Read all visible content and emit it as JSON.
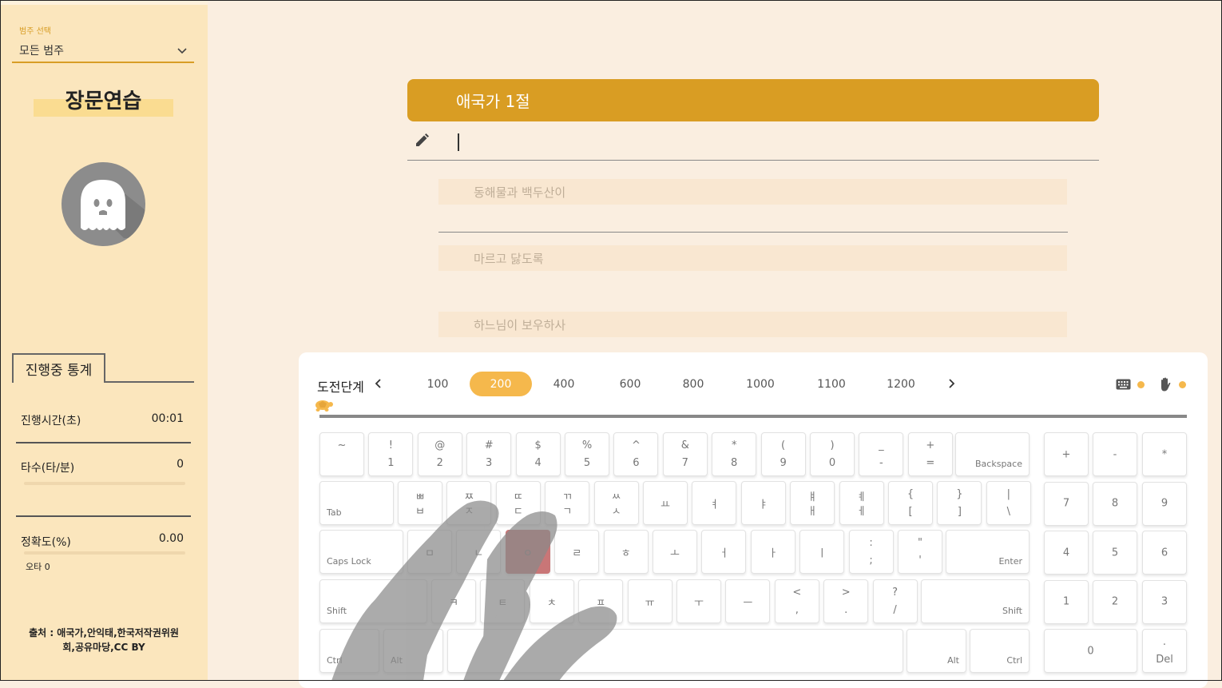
{
  "sidebar": {
    "category_label": "범주 선택",
    "category_value": "모든 범주",
    "title": "장문연습",
    "stats_tab": "진행중 통계",
    "stats": {
      "time_label": "진행시간(초)",
      "time_value": "00:01",
      "speed_label": "타수(타/분)",
      "speed_value": "0",
      "speed_progress": 0,
      "accuracy_label": "정확도(%)",
      "accuracy_value": "0.00",
      "accuracy_progress": 0,
      "typo_label": "오타 0"
    },
    "source": "출처 : 애국가,안익태,한국저작권위원회,공유마당,CC BY"
  },
  "main": {
    "banner_title": "애국가 1절",
    "input_value": "",
    "next_lines": [
      "동해물과 백두산이",
      "마르고 닳도록",
      "하느님이 보우하사"
    ]
  },
  "keyboard": {
    "level_label": "도전단계",
    "levels": [
      "100",
      "200",
      "400",
      "600",
      "800",
      "1000",
      "1100",
      "1200"
    ],
    "active_level": "200",
    "accent": "#f5b84c",
    "highlight_color": "#c97677",
    "rows": {
      "r1": [
        {
          "t": "~",
          "b": ""
        },
        {
          "t": "!",
          "b": "1"
        },
        {
          "t": "@",
          "b": "2"
        },
        {
          "t": "#",
          "b": "3"
        },
        {
          "t": "$",
          "b": "4"
        },
        {
          "t": "%",
          "b": "5"
        },
        {
          "t": "^",
          "b": "6"
        },
        {
          "t": "&",
          "b": "7"
        },
        {
          "t": "*",
          "b": "8"
        },
        {
          "t": "(",
          "b": "9"
        },
        {
          "t": ")",
          "b": "0"
        },
        {
          "t": "_",
          "b": "-"
        },
        {
          "t": "+",
          "b": "="
        }
      ],
      "backspace": "Backspace",
      "tab": "Tab",
      "r2": [
        {
          "t": "ㅃ",
          "b": "ㅂ"
        },
        {
          "t": "ㅉ",
          "b": "ㅈ"
        },
        {
          "t": "ㄸ",
          "b": "ㄷ"
        },
        {
          "t": "ㄲ",
          "b": "ㄱ"
        },
        {
          "t": "ㅆ",
          "b": "ㅅ"
        },
        {
          "t": "",
          "c": "ㅛ"
        },
        {
          "t": "",
          "c": "ㅕ"
        },
        {
          "t": "",
          "c": "ㅑ"
        },
        {
          "t": "ㅒ",
          "b": "ㅐ"
        },
        {
          "t": "ㅖ",
          "b": "ㅔ"
        },
        {
          "t": "{",
          "b": "["
        },
        {
          "t": "}",
          "b": "]"
        },
        {
          "t": "|",
          "b": "\\"
        }
      ],
      "caps": "Caps Lock",
      "r3": [
        {
          "c": "ㅁ"
        },
        {
          "c": "ㄴ"
        },
        {
          "c": "ㅇ"
        },
        {
          "c": "ㄹ"
        },
        {
          "c": "ㅎ"
        },
        {
          "c": "ㅗ"
        },
        {
          "c": "ㅓ"
        },
        {
          "c": "ㅏ"
        },
        {
          "c": "ㅣ"
        },
        {
          "t": ":",
          "b": ";"
        },
        {
          "t": "\"",
          "b": "'"
        }
      ],
      "enter": "Enter",
      "shift": "Shift",
      "r4": [
        {
          "c": "ㅋ"
        },
        {
          "c": "ㅌ"
        },
        {
          "c": "ㅊ"
        },
        {
          "c": "ㅍ"
        },
        {
          "c": "ㅠ"
        },
        {
          "c": "ㅜ"
        },
        {
          "c": "ㅡ"
        },
        {
          "t": "<",
          "b": ","
        },
        {
          "t": ">",
          "b": "."
        },
        {
          "t": "?",
          "b": "/"
        }
      ],
      "ctrl": "Ctrl",
      "alt": "Alt",
      "numpad": {
        "r1": [
          "+",
          "-",
          "*"
        ],
        "r2": [
          "7",
          "8",
          "9"
        ],
        "r3": [
          "4",
          "5",
          "6"
        ],
        "r4": [
          "1",
          "2",
          "3"
        ],
        "zero": "0",
        "del_top": ".",
        "del": "Del"
      }
    }
  }
}
